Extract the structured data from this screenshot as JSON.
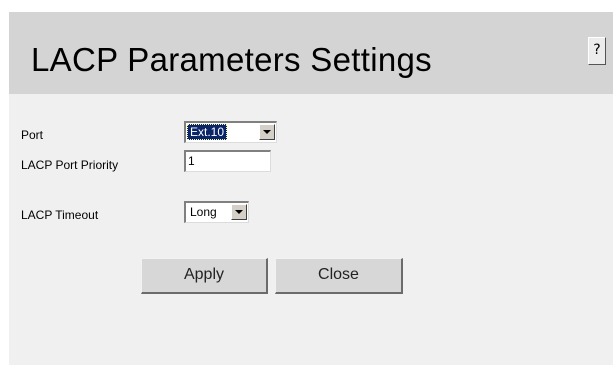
{
  "header": {
    "title": "LACP Parameters Settings",
    "help_label": "?"
  },
  "form": {
    "port": {
      "label": "Port",
      "value": "Ext.10"
    },
    "priority": {
      "label": "LACP Port Priority",
      "value": "1"
    },
    "timeout": {
      "label": "LACP Timeout",
      "value": "Long"
    }
  },
  "buttons": {
    "apply": "Apply",
    "close": "Close"
  },
  "colors": {
    "header_bg": "#d4d4d4",
    "content_bg": "#f0f0f0",
    "selection": "#0a246a"
  }
}
